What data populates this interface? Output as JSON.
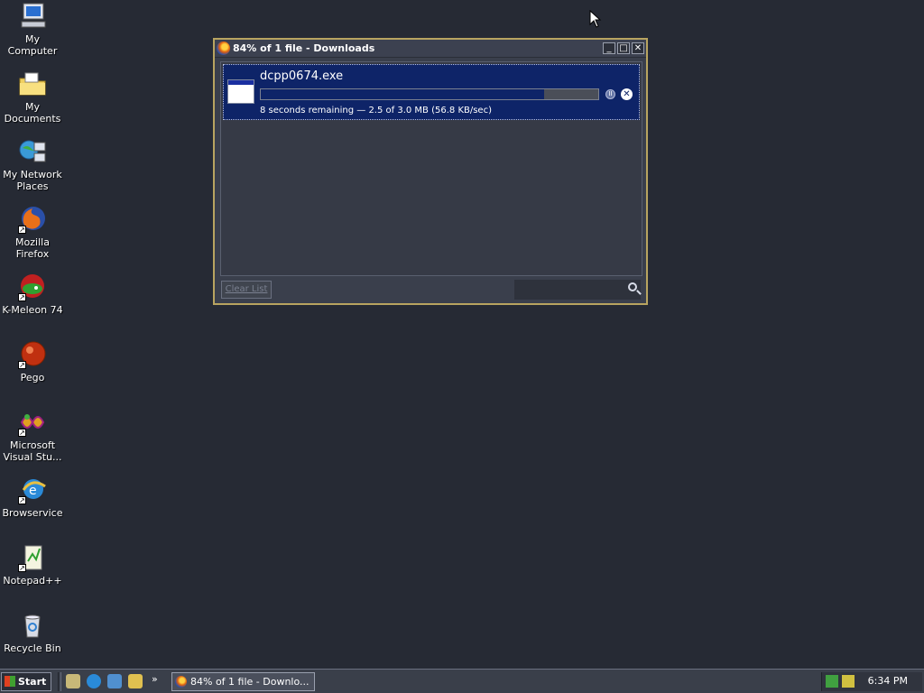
{
  "desktop": {
    "icons": [
      {
        "label": "My Computer"
      },
      {
        "label": "My Documents"
      },
      {
        "label": "My Network Places"
      },
      {
        "label": "Mozilla Firefox"
      },
      {
        "label": "K-Meleon 74"
      },
      {
        "label": "Pego"
      },
      {
        "label": "Microsoft Visual Stu..."
      },
      {
        "label": "Browservice"
      },
      {
        "label": "Notepad++"
      },
      {
        "label": "Recycle Bin"
      }
    ]
  },
  "downloads_window": {
    "title": "84% of 1 file - Downloads",
    "download": {
      "filename": "dcpp0674.exe",
      "progress_fraction": 0.84,
      "status": "8 seconds remaining — 2.5 of 3.0 MB (56.8 KB/sec)"
    },
    "clear_list_label": "Clear List",
    "search_placeholder": ""
  },
  "taskbar": {
    "start_label": "Start",
    "overflow_glyph": "»",
    "task_button_label": "84% of 1 file - Downlo...",
    "clock": "6:34 PM"
  },
  "colors": {
    "desktop_bg": "#262a34",
    "selection": "#0e2468",
    "window_border": "#b8a460"
  }
}
